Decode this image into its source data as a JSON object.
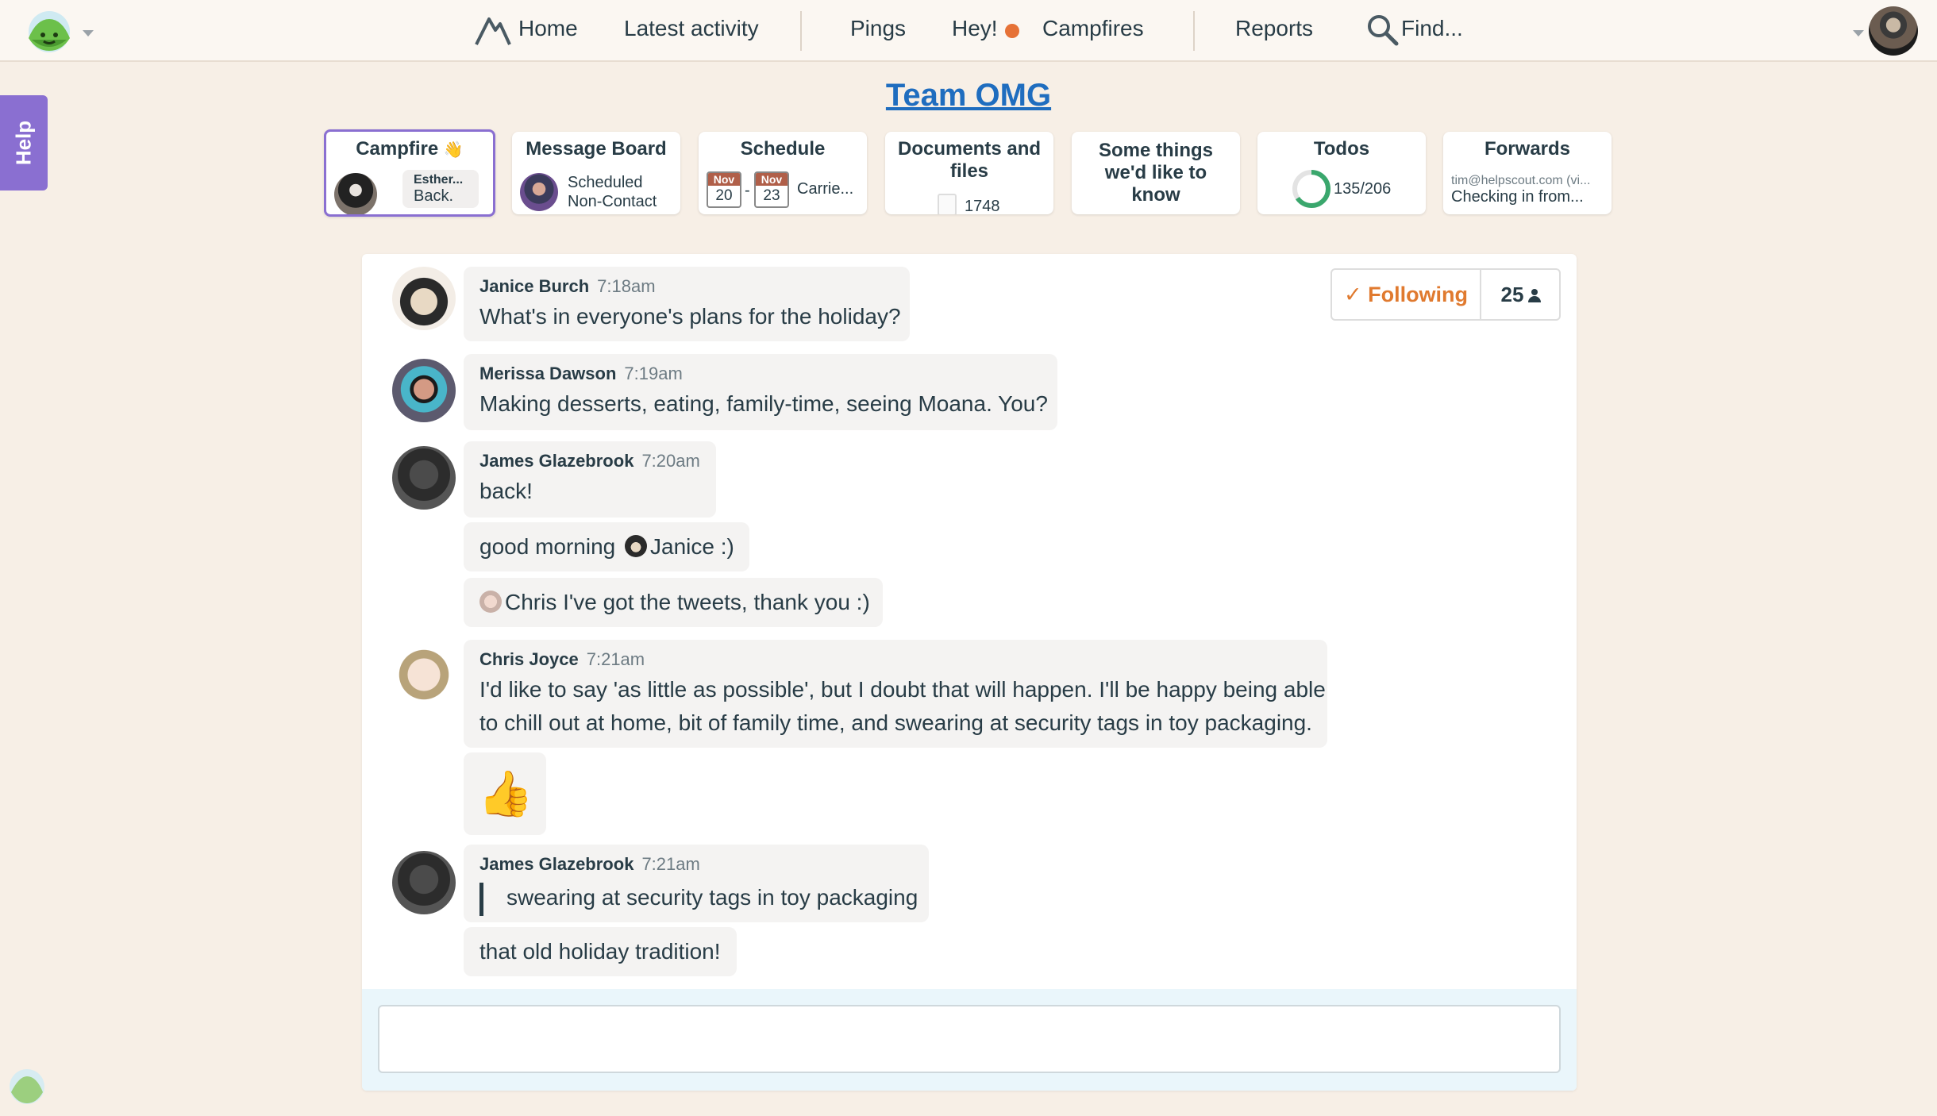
{
  "nav": {
    "home": "Home",
    "latest_activity": "Latest activity",
    "pings": "Pings",
    "hey": "Hey!",
    "campfires": "Campfires",
    "reports": "Reports",
    "find": "Find..."
  },
  "help": {
    "label": "Help"
  },
  "project": {
    "title": "Team OMG"
  },
  "cards": {
    "campfire": {
      "title": "Campfire",
      "emoji": "👋",
      "last_author": "Esther...",
      "last_message": "Back."
    },
    "message_board": {
      "title": "Message Board",
      "line1": "Scheduled",
      "line2": "Non-Contact"
    },
    "schedule": {
      "title": "Schedule",
      "start_month": "Nov",
      "start_day": "20",
      "dash": "-",
      "end_month": "Nov",
      "end_day": "23",
      "who": "Carrie..."
    },
    "documents": {
      "title": "Documents and files",
      "count": "1748"
    },
    "some_things": {
      "title": "Some things we'd like to know"
    },
    "todos": {
      "title": "Todos",
      "progress_text": "135/206",
      "completed": 135,
      "total": 206
    },
    "forwards": {
      "title": "Forwards",
      "from": "tim@helpscout.com (vi...",
      "subject": "Checking in from..."
    }
  },
  "following": {
    "label": "✓ Following",
    "count": "25"
  },
  "messages": [
    {
      "author": "Janice Burch",
      "time": "7:18am",
      "text": "What's in everyone's plans for the holiday?"
    },
    {
      "author": "Merissa Dawson",
      "time": "7:19am",
      "text": "Making desserts, eating, family-time, seeing Moana. You?"
    },
    {
      "author": "James Glazebrook",
      "time": "7:20am",
      "text": "back!"
    },
    {
      "text_before": "good morning",
      "mention": "Janice :)"
    },
    {
      "mention": "Chris I've got the tweets, thank you :)"
    },
    {
      "author": "Chris Joyce",
      "time": "7:21am",
      "line1": "I'd like to say 'as little as possible', but I doubt that will happen. I'll be happy being able",
      "line2": "to chill out at home, bit of family time, and swearing at security tags in toy packaging."
    },
    {
      "emoji": "👍"
    },
    {
      "author": "James Glazebrook",
      "time": "7:21am",
      "quote": "swearing at security tags in toy packaging"
    },
    {
      "text": "that old holiday tradition!"
    }
  ],
  "colors": {
    "background": "#f7efe6",
    "accent_purple": "#8a6fd1",
    "link_blue": "#1f6dbf",
    "following_orange": "#e07a2f",
    "notification_dot": "#e67237",
    "todo_green": "#3aa76d"
  },
  "icons": [
    "basecamp-logo-icon",
    "home-mountain-icon",
    "search-icon",
    "person-icon",
    "basecamp-mini-logo-icon"
  ]
}
